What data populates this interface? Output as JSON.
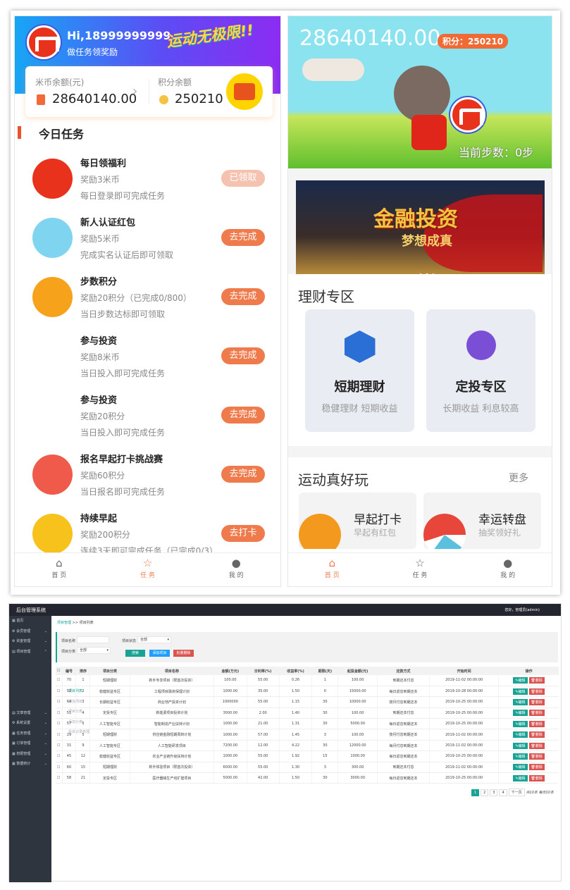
{
  "task_app": {
    "greeting": "Hi,18999999999",
    "subtitle": "做任务领奖励",
    "slogan": "运动无极限!!",
    "coin_label": "米币余额(元)",
    "coin_value": "28640140.00",
    "points_label": "积分余额",
    "points_value": "250210",
    "section_title": "今日任务",
    "tasks": [
      {
        "title": "每日领福利",
        "reward": "奖励3米币",
        "desc": "每日登录即可完成任务",
        "button": "已领取",
        "done": true,
        "icon": "check-in-icon",
        "color": "#e8321c"
      },
      {
        "title": "新人认证红包",
        "reward": "奖励5米币",
        "desc": "完成实名认证后即可领取",
        "button": "去完成",
        "done": false,
        "icon": "red-envelope-icon",
        "color": "#7fd4f0"
      },
      {
        "title": "步数积分",
        "reward": "奖励20积分（已完成0/800）",
        "desc": "当日步数达标即可领取",
        "button": "去完成",
        "done": false,
        "icon": "runner-icon",
        "color": "#f7a21b"
      },
      {
        "title": "参与投资",
        "reward": "奖励8米币",
        "desc": "当日投入即可完成任务",
        "button": "去完成",
        "done": false,
        "icon": "",
        "color": ""
      },
      {
        "title": "参与投资",
        "reward": "奖励20积分",
        "desc": "当日投入即可完成任务",
        "button": "去完成",
        "done": false,
        "icon": "",
        "color": ""
      },
      {
        "title": "报名早起打卡挑战赛",
        "reward": "奖励60积分",
        "desc": "当日报名即可完成任务",
        "button": "去完成",
        "done": false,
        "icon": "challenge-icon",
        "color": "#f05a4a"
      },
      {
        "title": "持续早起",
        "reward": "奖励200积分",
        "desc": "连续3天即可完成任务（已完成0/3）",
        "button": "去打卡",
        "done": false,
        "icon": "money-bag-icon",
        "color": "#f7c21b"
      }
    ],
    "nav": [
      {
        "label": "首 页",
        "icon": "home-icon"
      },
      {
        "label": "任 务",
        "icon": "star-icon",
        "active": true
      },
      {
        "label": "我 的",
        "icon": "user-icon"
      }
    ]
  },
  "home_app": {
    "balance": "28640140.00",
    "points_badge": "积分：250210",
    "steps": "当前步数：0步",
    "banner_title": "金融投资",
    "banner_subtitle": "梦想成真",
    "finance_title": "理财专区",
    "finance_cards": [
      {
        "name": "短期理财",
        "desc": "稳健理财 短期收益",
        "icon": "chart-hexagon-icon",
        "color": "#2a6fd6"
      },
      {
        "name": "定投专区",
        "desc": "长期收益 利息较高",
        "icon": "stopwatch-icon",
        "color": "#7a4fd6"
      }
    ],
    "sport_title": "运动真好玩",
    "more": "更多",
    "sport_cards": [
      {
        "name": "早起打卡",
        "desc": "早起有红包",
        "icon": "alarm-clock-icon",
        "color": "#f39a1e"
      },
      {
        "name": "幸运转盘",
        "desc": "抽奖领好礼",
        "icon": "wheel-icon",
        "color": "#e8463a"
      }
    ],
    "nav": [
      {
        "label": "首 页",
        "icon": "home-icon",
        "active": true
      },
      {
        "label": "任 务",
        "icon": "star-icon"
      },
      {
        "label": "我 的",
        "icon": "user-icon"
      }
    ]
  },
  "admin": {
    "title": "后台管理系统",
    "user": "您好，管理员(admin)",
    "sidebar": [
      {
        "label": "首页",
        "icon": "grid-icon"
      },
      {
        "label": "会员管理",
        "icon": "gear-icon",
        "arrow": "⌄"
      },
      {
        "label": "资金管理",
        "icon": "gear-icon",
        "arrow": "⌄"
      },
      {
        "label": "项目管理",
        "icon": "doc-icon",
        "arrow": "⌃"
      },
      {
        "label": "项目列表",
        "sub": true,
        "active": true
      },
      {
        "label": "添加项目",
        "sub": true
      },
      {
        "label": "项目分类",
        "sub": true
      },
      {
        "label": "添加分类",
        "sub": true
      },
      {
        "label": "投资记录管理",
        "sub": true
      },
      {
        "label": "文章管理",
        "icon": "doc-icon",
        "arrow": "⌄"
      },
      {
        "label": "系统设置",
        "icon": "gear-icon",
        "arrow": "⌄"
      },
      {
        "label": "任务管理",
        "icon": "grid-icon",
        "arrow": "⌄"
      },
      {
        "label": "订单管理",
        "icon": "grid-icon",
        "arrow": "⌄"
      },
      {
        "label": "权限管理",
        "icon": "grid-icon",
        "arrow": "⌄"
      },
      {
        "label": "数据统计",
        "icon": "grid-icon",
        "arrow": "⌄"
      }
    ],
    "breadcrumb": [
      "项目管理",
      "项目列表"
    ],
    "filter": {
      "name_label": "项目名称",
      "name_value": "",
      "status_label": "项目状态",
      "status_value": "全部",
      "category_label": "项目分类",
      "category_value": "全部",
      "search": "搜索",
      "add": "添加项目",
      "delete": "批量删除"
    },
    "columns": [
      "",
      "编号",
      "排序",
      "项目分类",
      "项目名称",
      "金额(万元)",
      "日利率(%)",
      "收益率(%)",
      "期限(天)",
      "起投金额(元)",
      "还款方式",
      "开始时间",
      "操作"
    ],
    "rows": [
      [
        "70",
        "1",
        "短期理财",
        "新手专享项目（限首次投资）",
        "100.00",
        "55.00",
        "0.26",
        "1",
        "100.00",
        "到期还本付息",
        "2019-11-02 00:00:00"
      ],
      [
        "52",
        "2",
        "稳健收益专区",
        "工程项目融资保理计划",
        "1000.00",
        "35.00",
        "1.50",
        "0",
        "15000.00",
        "每日返息到期还本",
        "2019-10-28 00:00:00"
      ],
      [
        "64",
        "3",
        "长期收益专区",
        "商业地产投资计划",
        "1000000",
        "55.00",
        "1.15",
        "30",
        "10000.00",
        "按月付息到期还本",
        "2019-10-25 00:00:00"
      ],
      [
        "51",
        "4",
        "定投专区",
        "新能源项目投资计划",
        "3000.00",
        "2.00",
        "1.40",
        "30",
        "100.00",
        "到期还本付息",
        "2019-10-25 00:00:00"
      ],
      [
        "57",
        "5",
        "人工智能专区",
        "智能制造产业扶持计划",
        "1000.00",
        "21.00",
        "1.31",
        "30",
        "5000.00",
        "每日返息到期还本",
        "2019-10-25 00:00:00"
      ],
      [
        "29",
        "5",
        "短期理财",
        "供应链金融短期周转计划",
        "1000.00",
        "57.00",
        "1.45",
        "3",
        "100.00",
        "按月付息到期还本",
        "2019-11-02 00:00:00"
      ],
      [
        "31",
        "9",
        "人工智能专区",
        "人工智能研发项目",
        "7200.00",
        "12.00",
        "4.22",
        "30",
        "12000.00",
        "每月付息到期还本",
        "2019-11-02 00:00:00"
      ],
      [
        "45",
        "12",
        "稳健收益专区",
        "农业产业链升级扶持计划",
        "1000.00",
        "55.00",
        "1.92",
        "15",
        "1000.00",
        "每日返息到期还本",
        "2019-10-25 00:00:00"
      ],
      [
        "60",
        "15",
        "短期理财",
        "新手体验项目（限首次投资）",
        "6000.00",
        "55.00",
        "1.30",
        "3",
        "300.00",
        "到期还本付息",
        "2019-11-02 00:00:00"
      ],
      [
        "58",
        "21",
        "定投专区",
        "医疗器械生产线扩建项目",
        "5000.00",
        "42.00",
        "1.50",
        "30",
        "3000.00",
        "每日返息到期还本",
        "2019-10-25 00:00:00"
      ]
    ],
    "edit": "编辑",
    "remove": "删除",
    "pages": [
      "1",
      "2",
      "3",
      "4",
      "下一页"
    ],
    "page_info": "共10条 每页10条",
    "colors": {
      "accent": "#19a394",
      "blue": "#1e9fff",
      "danger": "#d9534f",
      "topbar": "#23262e",
      "sidebar": "#2f353e"
    }
  }
}
